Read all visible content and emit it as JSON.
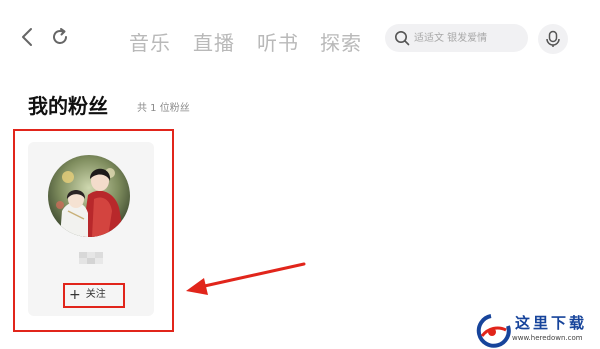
{
  "topbar": {
    "tabs": [
      {
        "label": "音乐"
      },
      {
        "label": "直播"
      },
      {
        "label": "听书"
      },
      {
        "label": "探索"
      }
    ],
    "search": {
      "placeholder": "适适文 银发爱情"
    }
  },
  "page": {
    "title": "我的粉丝",
    "count": "共 1 位粉丝"
  },
  "fan_card": {
    "username": "",
    "follow_label": "关注"
  },
  "colors": {
    "highlight": "#e1251b",
    "tab_inactive": "#b9b9b9",
    "card_bg": "#f5f5f5",
    "watermark_blue": "#17449b"
  },
  "watermark": {
    "text": "这里下载",
    "url": "www.heredown.com"
  }
}
